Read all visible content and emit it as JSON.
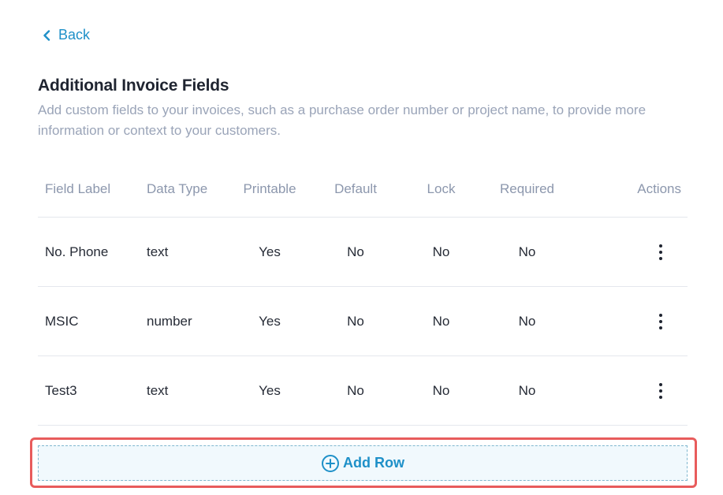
{
  "nav": {
    "back_label": "Back"
  },
  "page": {
    "title": "Additional Invoice Fields",
    "description": "Add custom fields to your invoices, such as a purchase order number or project name, to provide more information or context to your customers."
  },
  "table": {
    "headers": {
      "field_label": "Field Label",
      "data_type": "Data Type",
      "printable": "Printable",
      "default": "Default",
      "lock": "Lock",
      "required": "Required",
      "actions": "Actions"
    },
    "rows": [
      {
        "field_label": "No. Phone",
        "data_type": "text",
        "printable": "Yes",
        "default": "No",
        "lock": "No",
        "required": "No"
      },
      {
        "field_label": "MSIC",
        "data_type": "number",
        "printable": "Yes",
        "default": "No",
        "lock": "No",
        "required": "No"
      },
      {
        "field_label": "Test3",
        "data_type": "text",
        "printable": "Yes",
        "default": "No",
        "lock": "No",
        "required": "No"
      }
    ]
  },
  "add_row": {
    "label": "Add Row",
    "icon": "plus-circle-icon"
  },
  "colors": {
    "accent": "#1e90c8",
    "highlight_border": "#e85c5c",
    "muted_text": "#9aa4b8",
    "add_row_background": "#f1f9fd"
  }
}
